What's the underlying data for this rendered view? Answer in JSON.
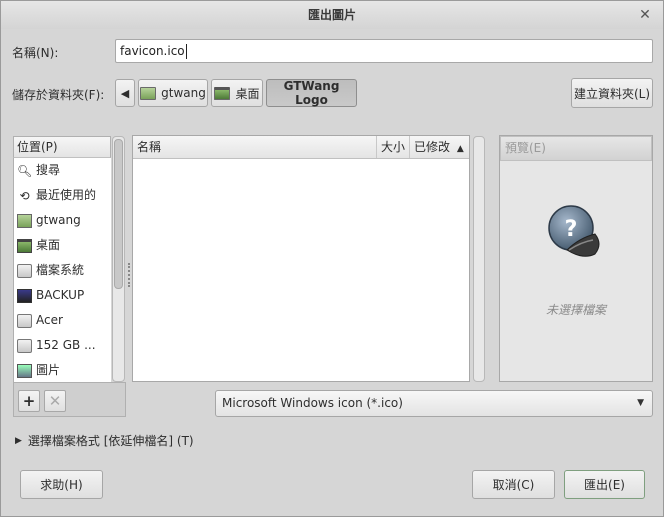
{
  "window": {
    "title": "匯出圖片"
  },
  "name_row": {
    "label": "名稱(N):",
    "value": "favicon.ico"
  },
  "save_row": {
    "label": "儲存於資料夾(F):",
    "path": [
      "gtwang",
      "桌面",
      "GTWang Logo"
    ],
    "create_folder_label": "建立資料夾(L)"
  },
  "places": {
    "header": "位置(P)",
    "items": [
      {
        "label": "搜尋",
        "icon": "search-icon"
      },
      {
        "label": "最近使用的",
        "icon": "recent-icon"
      },
      {
        "label": "gtwang",
        "icon": "home-folder-icon"
      },
      {
        "label": "桌面",
        "icon": "desktop-folder-icon"
      },
      {
        "label": "檔案系統",
        "icon": "drive-icon"
      },
      {
        "label": "BACKUP",
        "icon": "usb-drive-icon"
      },
      {
        "label": "Acer",
        "icon": "drive-icon"
      },
      {
        "label": "152 GB ...",
        "icon": "drive-icon"
      },
      {
        "label": "圖片",
        "icon": "pictures-folder-icon"
      }
    ]
  },
  "files": {
    "col_name": "名稱",
    "col_size": "大小",
    "col_modified": "已修改"
  },
  "preview": {
    "header": "預覽(E)",
    "empty_text": "未選擇檔案"
  },
  "filter": {
    "selected": "Microsoft Windows icon (*.ico)"
  },
  "expander": {
    "label": "選擇檔案格式 [依延伸檔名] (T)"
  },
  "buttons": {
    "help": "求助(H)",
    "cancel": "取消(C)",
    "export": "匯出(E)"
  }
}
